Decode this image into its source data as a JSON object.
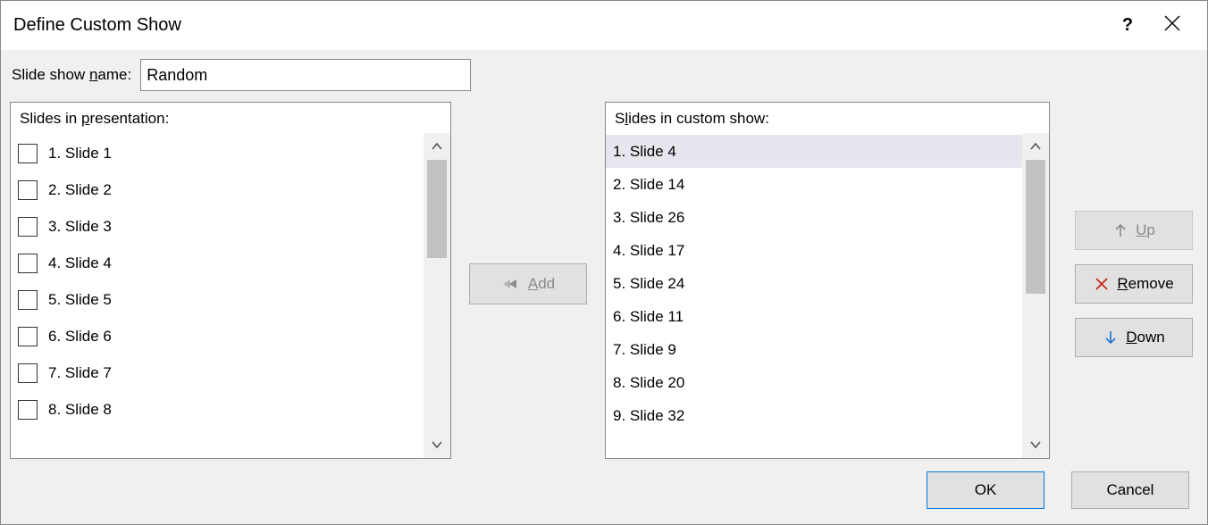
{
  "title": "Define Custom Show",
  "name_label_pre": "Slide show ",
  "name_label_u": "n",
  "name_label_post": "ame:",
  "name_value": "Random",
  "left_header_pre": "Slides in ",
  "left_header_u": "p",
  "left_header_post": "resentation:",
  "left_items": [
    {
      "label": "1. Slide 1"
    },
    {
      "label": "2. Slide 2"
    },
    {
      "label": "3. Slide 3"
    },
    {
      "label": "4. Slide 4"
    },
    {
      "label": "5. Slide 5"
    },
    {
      "label": "6. Slide 6"
    },
    {
      "label": "7. Slide 7"
    },
    {
      "label": "8. Slide 8"
    }
  ],
  "right_header_pre": "S",
  "right_header_u": "l",
  "right_header_post": "ides in custom show:",
  "right_items": [
    {
      "label": "1. Slide 4",
      "selected": true
    },
    {
      "label": "2. Slide 14"
    },
    {
      "label": "3. Slide 26"
    },
    {
      "label": "4. Slide 17"
    },
    {
      "label": "5. Slide 24"
    },
    {
      "label": "6. Slide 11"
    },
    {
      "label": "7. Slide 9"
    },
    {
      "label": "8. Slide 20"
    },
    {
      "label": "9. Slide 32"
    }
  ],
  "add_u": "A",
  "add_post": "dd",
  "up_u": "U",
  "up_post": "p",
  "remove_u": "R",
  "remove_post": "emove",
  "down_u": "D",
  "down_post": "own",
  "ok_label": "OK",
  "cancel_label": "Cancel"
}
